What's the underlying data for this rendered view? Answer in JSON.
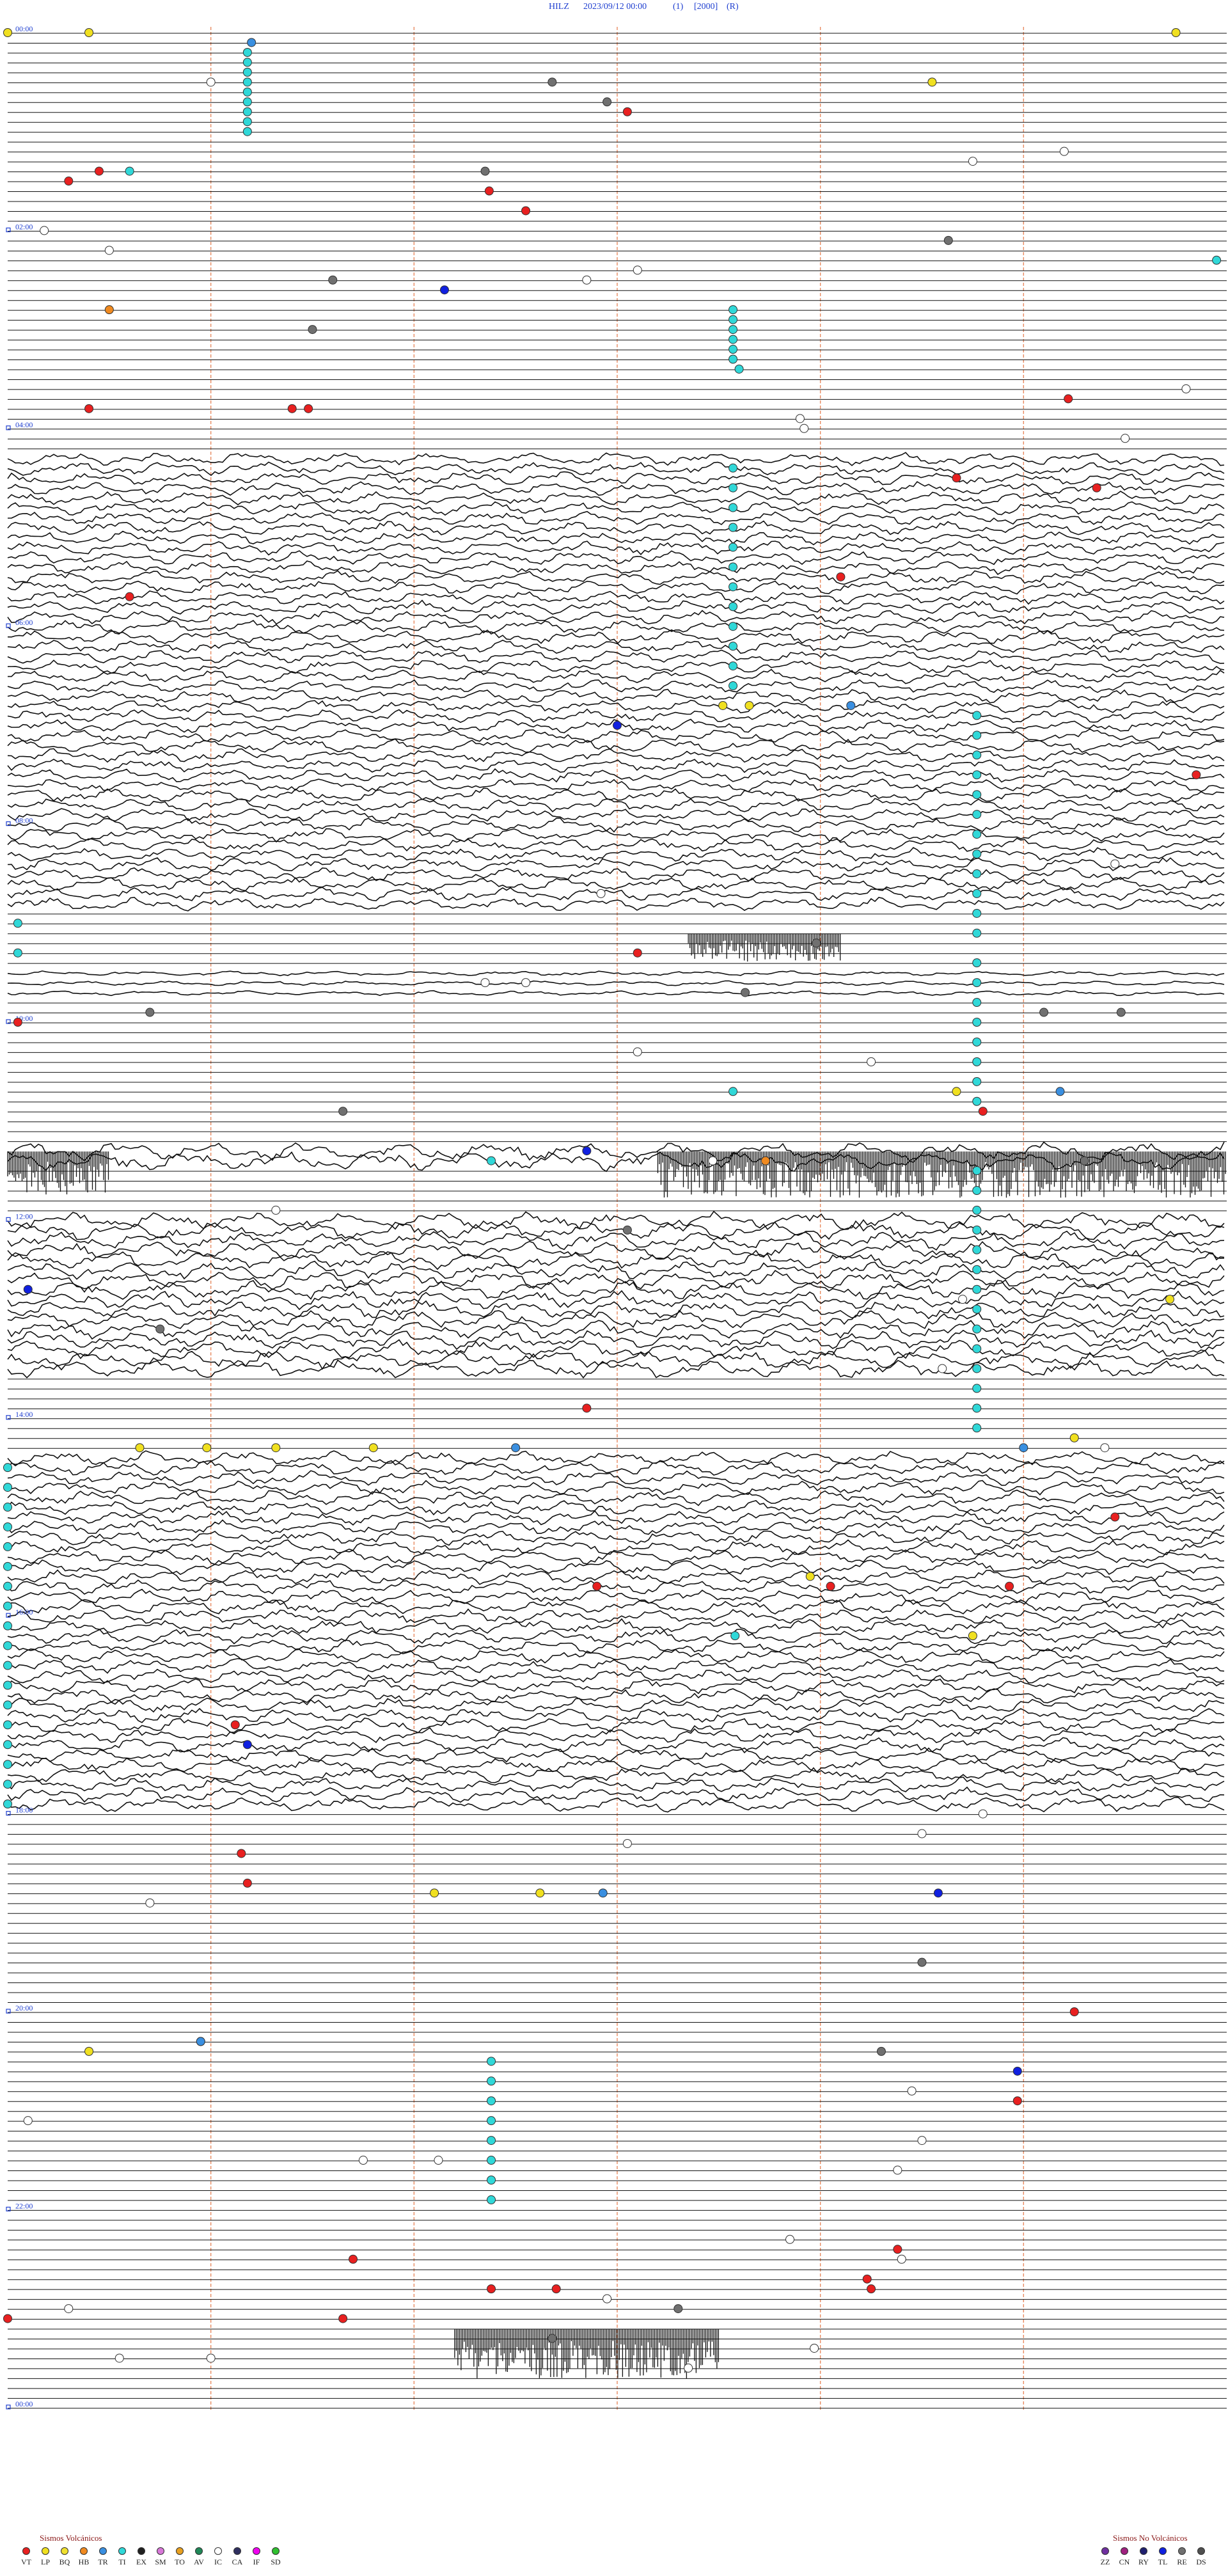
{
  "header": {
    "station": "HILZ",
    "datetime": "2023/09/12 00:00",
    "channel": "(1)",
    "scale": "[2000]",
    "mode": "(R)"
  },
  "chart_data": {
    "type": "helicorder",
    "title": "HILZ   2023/09/12 00:00   (1)   [2000]  (R)",
    "time_labels": [
      "00:00",
      "02:00",
      "04:00",
      "06:00",
      "08:00",
      "10:00",
      "12:00",
      "14:00",
      "16:00",
      "18:00",
      "20:00",
      "22:00",
      "00:00"
    ],
    "rows_per_hour": 10,
    "row_minutes": 6,
    "minute_markers": [
      1,
      2,
      3,
      4,
      5
    ],
    "noise_hours": [
      {
        "start": 4.3,
        "end": 8.8,
        "level": 0.55
      },
      {
        "start": 9.5,
        "end": 9.7,
        "level": 0.2
      },
      {
        "start": 11.3,
        "end": 11.4,
        "level": 0.8
      },
      {
        "start": 12.0,
        "end": 13.5,
        "level": 0.75
      },
      {
        "start": 14.4,
        "end": 17.9,
        "level": 0.6
      }
    ],
    "bursts": [
      {
        "hour": 9.1,
        "start_min": 3.35,
        "end_min": 4.1,
        "amp": 0.9
      },
      {
        "hour": 11.3,
        "start_min": 0.0,
        "end_min": 0.5,
        "amp": 1.4
      },
      {
        "hour": 11.3,
        "start_min": 3.2,
        "end_min": 6.0,
        "amp": 1.5
      },
      {
        "hour": 23.2,
        "start_min": 2.2,
        "end_min": 3.5,
        "amp": 1.6
      }
    ],
    "event_codes_volcanic": [
      "VT",
      "LP",
      "BQ",
      "HB",
      "TR",
      "TI",
      "EX",
      "SM",
      "TO",
      "AV",
      "IC",
      "CA",
      "IF",
      "SD"
    ],
    "event_codes_non_volcanic": [
      "ZZ",
      "CN",
      "RY",
      "TL",
      "RE",
      "DS"
    ],
    "event_colors": {
      "VT": "#e82020",
      "LP": "#f0e020",
      "BQ": "#f0e030",
      "HB": "#f08a20",
      "TR": "#3a8fe0",
      "TI": "#30d8d8",
      "EX": "#202020",
      "SM": "#d878d8",
      "TO": "#e8a020",
      "AV": "#208858",
      "IC": "#ffffff",
      "CA": "#303060",
      "IF": "#f000f0",
      "SD": "#30c030",
      "ZZ": "#7030a0",
      "CN": "#a02080",
      "RY": "#202070",
      "TL": "#1020e0",
      "RE": "#707070",
      "DS": "#505050"
    },
    "events": [
      {
        "t": 0.0,
        "m": 0.0,
        "c": "LP"
      },
      {
        "t": 0.0,
        "m": 0.4,
        "c": "LP"
      },
      {
        "t": 0.0,
        "m": 5.75,
        "c": "LP"
      },
      {
        "t": 0.1,
        "m": 1.2,
        "c": "TR"
      },
      {
        "t": 0.2,
        "m": 1.18,
        "c": "TI"
      },
      {
        "t": 0.3,
        "m": 1.18,
        "c": "TI"
      },
      {
        "t": 0.4,
        "m": 1.18,
        "c": "TI"
      },
      {
        "t": 0.5,
        "m": 1.18,
        "c": "TI"
      },
      {
        "t": 0.6,
        "m": 1.18,
        "c": "TI"
      },
      {
        "t": 0.7,
        "m": 1.18,
        "c": "TI"
      },
      {
        "t": 0.8,
        "m": 1.18,
        "c": "TI"
      },
      {
        "t": 0.9,
        "m": 1.18,
        "c": "TI"
      },
      {
        "t": 1.0,
        "m": 1.18,
        "c": "TI"
      },
      {
        "t": 0.5,
        "m": 1.0,
        "c": "IC"
      },
      {
        "t": 0.5,
        "m": 2.68,
        "c": "RE"
      },
      {
        "t": 0.5,
        "m": 4.55,
        "c": "LP"
      },
      {
        "t": 0.7,
        "m": 2.95,
        "c": "RE"
      },
      {
        "t": 0.8,
        "m": 3.05,
        "c": "VT"
      },
      {
        "t": 1.2,
        "m": 5.2,
        "c": "IC"
      },
      {
        "t": 1.3,
        "m": 4.75,
        "c": "IC"
      },
      {
        "t": 1.4,
        "m": 0.45,
        "c": "VT"
      },
      {
        "t": 1.4,
        "m": 0.6,
        "c": "TI"
      },
      {
        "t": 1.4,
        "m": 2.35,
        "c": "RE"
      },
      {
        "t": 1.5,
        "m": 0.3,
        "c": "VT"
      },
      {
        "t": 1.6,
        "m": 2.37,
        "c": "VT"
      },
      {
        "t": 1.8,
        "m": 2.55,
        "c": "VT"
      },
      {
        "t": 2.0,
        "m": 0.18,
        "c": "IC"
      },
      {
        "t": 2.1,
        "m": 4.63,
        "c": "RE"
      },
      {
        "t": 2.2,
        "m": 0.5,
        "c": "IC"
      },
      {
        "t": 2.3,
        "m": 5.95,
        "c": "TI"
      },
      {
        "t": 2.4,
        "m": 3.1,
        "c": "IC"
      },
      {
        "t": 2.5,
        "m": 2.85,
        "c": "IC"
      },
      {
        "t": 2.5,
        "m": 1.6,
        "c": "RE"
      },
      {
        "t": 2.6,
        "m": 2.15,
        "c": "TL"
      },
      {
        "t": 2.8,
        "m": 0.5,
        "c": "HB"
      },
      {
        "t": 2.8,
        "m": 3.57,
        "c": "TI"
      },
      {
        "t": 2.9,
        "m": 3.57,
        "c": "TI"
      },
      {
        "t": 3.0,
        "m": 3.57,
        "c": "TI"
      },
      {
        "t": 3.1,
        "m": 3.57,
        "c": "TI"
      },
      {
        "t": 3.2,
        "m": 3.57,
        "c": "TI"
      },
      {
        "t": 3.3,
        "m": 3.57,
        "c": "TI"
      },
      {
        "t": 3.4,
        "m": 3.6,
        "c": "TI"
      },
      {
        "t": 3.0,
        "m": 1.5,
        "c": "RE"
      },
      {
        "t": 3.6,
        "m": 5.8,
        "c": "IC"
      },
      {
        "t": 3.7,
        "m": 5.22,
        "c": "VT"
      },
      {
        "t": 3.8,
        "m": 0.4,
        "c": "VT"
      },
      {
        "t": 3.8,
        "m": 1.4,
        "c": "VT"
      },
      {
        "t": 3.8,
        "m": 1.48,
        "c": "VT"
      },
      {
        "t": 3.9,
        "m": 3.9,
        "c": "IC"
      },
      {
        "t": 4.0,
        "m": 3.92,
        "c": "IC"
      },
      {
        "t": 4.1,
        "m": 5.5,
        "c": "IC"
      },
      {
        "t": 4.5,
        "m": 4.67,
        "c": "VT"
      },
      {
        "t": 4.6,
        "m": 5.36,
        "c": "VT"
      },
      {
        "t": 5.5,
        "m": 4.1,
        "c": "VT"
      },
      {
        "t": 5.7,
        "m": 0.6,
        "c": "VT"
      },
      {
        "t": 4.4,
        "m": 3.57,
        "c": "TI"
      },
      {
        "t": 4.6,
        "m": 3.57,
        "c": "TI"
      },
      {
        "t": 4.8,
        "m": 3.57,
        "c": "TI"
      },
      {
        "t": 5.0,
        "m": 3.57,
        "c": "TI"
      },
      {
        "t": 5.2,
        "m": 3.57,
        "c": "TI"
      },
      {
        "t": 5.4,
        "m": 3.57,
        "c": "TI"
      },
      {
        "t": 5.6,
        "m": 3.57,
        "c": "TI"
      },
      {
        "t": 5.8,
        "m": 3.57,
        "c": "TI"
      },
      {
        "t": 6.0,
        "m": 3.57,
        "c": "TI"
      },
      {
        "t": 6.2,
        "m": 3.57,
        "c": "TI"
      },
      {
        "t": 6.4,
        "m": 3.57,
        "c": "TI"
      },
      {
        "t": 6.6,
        "m": 3.57,
        "c": "TI"
      },
      {
        "t": 6.8,
        "m": 3.52,
        "c": "LP"
      },
      {
        "t": 6.8,
        "m": 3.65,
        "c": "LP"
      },
      {
        "t": 6.8,
        "m": 4.15,
        "c": "TR"
      },
      {
        "t": 7.0,
        "m": 3.0,
        "c": "TL"
      },
      {
        "t": 7.5,
        "m": 5.85,
        "c": "VT"
      },
      {
        "t": 6.9,
        "m": 4.77,
        "c": "TI"
      },
      {
        "t": 7.1,
        "m": 4.77,
        "c": "TI"
      },
      {
        "t": 7.3,
        "m": 4.77,
        "c": "TI"
      },
      {
        "t": 7.5,
        "m": 4.77,
        "c": "TI"
      },
      {
        "t": 7.7,
        "m": 4.77,
        "c": "TI"
      },
      {
        "t": 7.9,
        "m": 4.77,
        "c": "TI"
      },
      {
        "t": 8.1,
        "m": 4.77,
        "c": "TI"
      },
      {
        "t": 8.3,
        "m": 4.77,
        "c": "TI"
      },
      {
        "t": 8.5,
        "m": 4.77,
        "c": "TI"
      },
      {
        "t": 8.7,
        "m": 4.77,
        "c": "TI"
      },
      {
        "t": 8.9,
        "m": 4.77,
        "c": "TI"
      },
      {
        "t": 9.1,
        "m": 4.77,
        "c": "TI"
      },
      {
        "t": 8.7,
        "m": 2.92,
        "c": "IC"
      },
      {
        "t": 8.4,
        "m": 5.45,
        "c": "IC"
      },
      {
        "t": 9.0,
        "m": 0.05,
        "c": "TI"
      },
      {
        "t": 9.2,
        "m": 3.98,
        "c": "RE"
      },
      {
        "t": 9.3,
        "m": 3.1,
        "c": "VT"
      },
      {
        "t": 9.3,
        "m": 0.05,
        "c": "TI"
      },
      {
        "t": 9.4,
        "m": 4.77,
        "c": "TI"
      },
      {
        "t": 9.6,
        "m": 4.77,
        "c": "TI"
      },
      {
        "t": 9.8,
        "m": 4.77,
        "c": "TI"
      },
      {
        "t": 10.0,
        "m": 4.77,
        "c": "TI"
      },
      {
        "t": 10.2,
        "m": 4.77,
        "c": "TI"
      },
      {
        "t": 10.4,
        "m": 4.77,
        "c": "TI"
      },
      {
        "t": 10.6,
        "m": 4.77,
        "c": "TI"
      },
      {
        "t": 10.8,
        "m": 4.77,
        "c": "TI"
      },
      {
        "t": 9.6,
        "m": 2.35,
        "c": "IC"
      },
      {
        "t": 9.6,
        "m": 2.55,
        "c": "IC"
      },
      {
        "t": 9.7,
        "m": 3.63,
        "c": "RE"
      },
      {
        "t": 9.9,
        "m": 0.7,
        "c": "RE"
      },
      {
        "t": 9.9,
        "m": 5.1,
        "c": "RE"
      },
      {
        "t": 9.9,
        "m": 5.48,
        "c": "RE"
      },
      {
        "t": 10.0,
        "m": 0.05,
        "c": "VT"
      },
      {
        "t": 10.3,
        "m": 3.1,
        "c": "IC"
      },
      {
        "t": 10.4,
        "m": 4.25,
        "c": "IC"
      },
      {
        "t": 10.7,
        "m": 3.57,
        "c": "TI"
      },
      {
        "t": 10.7,
        "m": 4.67,
        "c": "LP"
      },
      {
        "t": 10.7,
        "m": 5.18,
        "c": "TR"
      },
      {
        "t": 10.9,
        "m": 1.65,
        "c": "RE"
      },
      {
        "t": 10.9,
        "m": 4.8,
        "c": "VT"
      },
      {
        "t": 11.3,
        "m": 2.85,
        "c": "TL"
      },
      {
        "t": 11.4,
        "m": 2.38,
        "c": "TI"
      },
      {
        "t": 11.4,
        "m": 3.47,
        "c": "IC"
      },
      {
        "t": 11.4,
        "m": 3.73,
        "c": "HB"
      },
      {
        "t": 11.4,
        "m": 5.3,
        "c": "RE"
      },
      {
        "t": 11.5,
        "m": 4.77,
        "c": "TI"
      },
      {
        "t": 11.7,
        "m": 4.77,
        "c": "TI"
      },
      {
        "t": 11.9,
        "m": 4.77,
        "c": "TI"
      },
      {
        "t": 12.1,
        "m": 4.77,
        "c": "TI"
      },
      {
        "t": 12.3,
        "m": 4.77,
        "c": "TI"
      },
      {
        "t": 12.5,
        "m": 4.77,
        "c": "TI"
      },
      {
        "t": 12.7,
        "m": 4.77,
        "c": "TI"
      },
      {
        "t": 12.9,
        "m": 4.77,
        "c": "TI"
      },
      {
        "t": 13.1,
        "m": 4.77,
        "c": "TI"
      },
      {
        "t": 13.3,
        "m": 4.77,
        "c": "TI"
      },
      {
        "t": 13.5,
        "m": 4.77,
        "c": "TI"
      },
      {
        "t": 13.7,
        "m": 4.77,
        "c": "TI"
      },
      {
        "t": 13.9,
        "m": 4.77,
        "c": "TI"
      },
      {
        "t": 14.1,
        "m": 4.77,
        "c": "TI"
      },
      {
        "t": 11.9,
        "m": 1.32,
        "c": "IC"
      },
      {
        "t": 12.1,
        "m": 3.05,
        "c": "RE"
      },
      {
        "t": 12.7,
        "m": 0.1,
        "c": "TL"
      },
      {
        "t": 12.8,
        "m": 4.7,
        "c": "IC"
      },
      {
        "t": 12.8,
        "m": 5.72,
        "c": "LP"
      },
      {
        "t": 13.1,
        "m": 0.75,
        "c": "RE"
      },
      {
        "t": 13.5,
        "m": 4.6,
        "c": "IC"
      },
      {
        "t": 13.9,
        "m": 2.85,
        "c": "VT"
      },
      {
        "t": 14.2,
        "m": 5.25,
        "c": "LP"
      },
      {
        "t": 14.3,
        "m": 0.65,
        "c": "LP"
      },
      {
        "t": 14.3,
        "m": 0.98,
        "c": "LP"
      },
      {
        "t": 14.3,
        "m": 1.32,
        "c": "LP"
      },
      {
        "t": 14.3,
        "m": 1.8,
        "c": "LP"
      },
      {
        "t": 14.3,
        "m": 2.5,
        "c": "TR"
      },
      {
        "t": 14.3,
        "m": 5.0,
        "c": "TR"
      },
      {
        "t": 14.3,
        "m": 5.4,
        "c": "IC"
      },
      {
        "t": 14.5,
        "m": 0.0,
        "c": "TI"
      },
      {
        "t": 14.7,
        "m": 0.0,
        "c": "TI"
      },
      {
        "t": 14.9,
        "m": 0.0,
        "c": "TI"
      },
      {
        "t": 15.1,
        "m": 0.0,
        "c": "TI"
      },
      {
        "t": 15.3,
        "m": 0.0,
        "c": "TI"
      },
      {
        "t": 15.5,
        "m": 0.0,
        "c": "TI"
      },
      {
        "t": 15.7,
        "m": 0.0,
        "c": "TI"
      },
      {
        "t": 15.9,
        "m": 0.0,
        "c": "TI"
      },
      {
        "t": 16.1,
        "m": 0.0,
        "c": "TI"
      },
      {
        "t": 16.3,
        "m": 0.0,
        "c": "TI"
      },
      {
        "t": 16.5,
        "m": 0.0,
        "c": "TI"
      },
      {
        "t": 16.7,
        "m": 0.0,
        "c": "TI"
      },
      {
        "t": 16.9,
        "m": 0.0,
        "c": "TI"
      },
      {
        "t": 17.1,
        "m": 0.0,
        "c": "TI"
      },
      {
        "t": 17.3,
        "m": 0.0,
        "c": "TI"
      },
      {
        "t": 17.5,
        "m": 0.0,
        "c": "TI"
      },
      {
        "t": 17.7,
        "m": 0.0,
        "c": "TI"
      },
      {
        "t": 17.9,
        "m": 0.0,
        "c": "TI"
      },
      {
        "t": 15.0,
        "m": 5.45,
        "c": "VT"
      },
      {
        "t": 15.6,
        "m": 3.95,
        "c": "LP"
      },
      {
        "t": 15.7,
        "m": 4.05,
        "c": "VT"
      },
      {
        "t": 15.7,
        "m": 4.93,
        "c": "VT"
      },
      {
        "t": 15.7,
        "m": 2.9,
        "c": "VT"
      },
      {
        "t": 16.2,
        "m": 4.75,
        "c": "LP"
      },
      {
        "t": 16.2,
        "m": 3.58,
        "c": "TI"
      },
      {
        "t": 17.1,
        "m": 1.12,
        "c": "VT"
      },
      {
        "t": 17.3,
        "m": 1.18,
        "c": "TL"
      },
      {
        "t": 18.0,
        "m": 4.8,
        "c": "IC"
      },
      {
        "t": 18.2,
        "m": 4.5,
        "c": "IC"
      },
      {
        "t": 18.3,
        "m": 3.05,
        "c": "IC"
      },
      {
        "t": 18.4,
        "m": 1.15,
        "c": "VT"
      },
      {
        "t": 18.7,
        "m": 1.18,
        "c": "VT"
      },
      {
        "t": 18.8,
        "m": 2.1,
        "c": "LP"
      },
      {
        "t": 18.8,
        "m": 2.62,
        "c": "LP"
      },
      {
        "t": 18.8,
        "m": 2.93,
        "c": "TR"
      },
      {
        "t": 18.8,
        "m": 4.58,
        "c": "TL"
      },
      {
        "t": 18.9,
        "m": 0.7,
        "c": "IC"
      },
      {
        "t": 19.5,
        "m": 4.5,
        "c": "RE"
      },
      {
        "t": 20.0,
        "m": 5.25,
        "c": "VT"
      },
      {
        "t": 20.3,
        "m": 0.95,
        "c": "VT"
      },
      {
        "t": 20.3,
        "m": 0.95,
        "c": "TR"
      },
      {
        "t": 20.4,
        "m": 0.4,
        "c": "LP"
      },
      {
        "t": 20.4,
        "m": 4.3,
        "c": "RE"
      },
      {
        "t": 20.6,
        "m": 4.97,
        "c": "TL"
      },
      {
        "t": 20.9,
        "m": 4.97,
        "c": "VT"
      },
      {
        "t": 20.8,
        "m": 4.45,
        "c": "IC"
      },
      {
        "t": 20.5,
        "m": 2.38,
        "c": "TI"
      },
      {
        "t": 20.7,
        "m": 2.38,
        "c": "TI"
      },
      {
        "t": 20.9,
        "m": 2.38,
        "c": "TI"
      },
      {
        "t": 21.1,
        "m": 2.38,
        "c": "TI"
      },
      {
        "t": 21.3,
        "m": 2.38,
        "c": "TI"
      },
      {
        "t": 21.5,
        "m": 2.38,
        "c": "TI"
      },
      {
        "t": 21.7,
        "m": 2.38,
        "c": "TI"
      },
      {
        "t": 21.9,
        "m": 2.38,
        "c": "TI"
      },
      {
        "t": 21.1,
        "m": 0.1,
        "c": "IC"
      },
      {
        "t": 21.3,
        "m": 4.5,
        "c": "IC"
      },
      {
        "t": 21.5,
        "m": 1.75,
        "c": "IC"
      },
      {
        "t": 21.5,
        "m": 2.12,
        "c": "IC"
      },
      {
        "t": 21.6,
        "m": 4.38,
        "c": "IC"
      },
      {
        "t": 22.3,
        "m": 3.85,
        "c": "IC"
      },
      {
        "t": 22.4,
        "m": 4.38,
        "c": "VT"
      },
      {
        "t": 22.5,
        "m": 1.7,
        "c": "VT"
      },
      {
        "t": 22.5,
        "m": 4.4,
        "c": "IC"
      },
      {
        "t": 22.7,
        "m": 4.23,
        "c": "VT"
      },
      {
        "t": 22.8,
        "m": 2.7,
        "c": "VT"
      },
      {
        "t": 22.8,
        "m": 4.25,
        "c": "VT"
      },
      {
        "t": 22.8,
        "m": 2.38,
        "c": "VT"
      },
      {
        "t": 22.9,
        "m": 2.95,
        "c": "IC"
      },
      {
        "t": 23.0,
        "m": 0.3,
        "c": "IC"
      },
      {
        "t": 23.0,
        "m": 3.3,
        "c": "RE"
      },
      {
        "t": 23.1,
        "m": 0.0,
        "c": "VT"
      },
      {
        "t": 23.1,
        "m": 1.65,
        "c": "VT"
      },
      {
        "t": 23.3,
        "m": 2.68,
        "c": "RE"
      },
      {
        "t": 23.4,
        "m": 3.97,
        "c": "IC"
      },
      {
        "t": 23.5,
        "m": 0.55,
        "c": "IC"
      },
      {
        "t": 23.5,
        "m": 1.0,
        "c": "IC"
      },
      {
        "t": 23.6,
        "m": 3.35,
        "c": "IC"
      }
    ]
  },
  "legend": {
    "volcanic_title": "Sismos Volcánicos",
    "non_volcanic_title": "Sismos No Volcánicos"
  }
}
